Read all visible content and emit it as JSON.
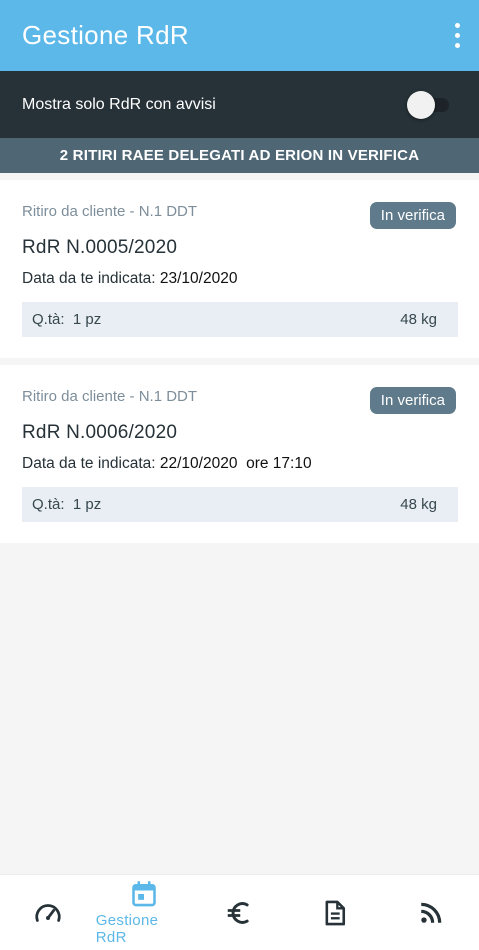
{
  "app_bar": {
    "title": "Gestione RdR",
    "menu_icon": "more-vert-icon"
  },
  "filter": {
    "label": "Mostra solo RdR con avvisi",
    "enabled": false
  },
  "banner": {
    "text": "2 RITIRI RAEE DELEGATI AD ERION IN VERIFICA"
  },
  "cards": [
    {
      "subtitle": "Ritiro da cliente - N.1 DDT",
      "badge": "In verifica",
      "title": "RdR N.0005/2020",
      "date_label": "Data da te indicata:",
      "date_value": "23/10/2020",
      "time_value": "",
      "qty_label": "Q.tà:",
      "qty_value": "1 pz",
      "weight": "48 kg"
    },
    {
      "subtitle": "Ritiro da cliente - N.1 DDT",
      "badge": "In verifica",
      "title": "RdR N.0006/2020",
      "date_label": "Data da te indicata:",
      "date_value": "22/10/2020",
      "time_value": "ore 17:10",
      "qty_label": "Q.tà:",
      "qty_value": "1 pz",
      "weight": "48 kg"
    }
  ],
  "bottom_nav": {
    "items": [
      {
        "icon": "speedometer-icon",
        "label": ""
      },
      {
        "icon": "calendar-icon",
        "label": "Gestione RdR",
        "active": true
      },
      {
        "icon": "euro-icon",
        "label": ""
      },
      {
        "icon": "document-icon",
        "label": ""
      },
      {
        "icon": "rss-feed-icon",
        "label": ""
      }
    ]
  },
  "colors": {
    "primary": "#5cb8e8",
    "dark_header": "#263238",
    "banner": "#4f6775",
    "badge": "#5f7a8a",
    "qty_background": "#e8eef3"
  }
}
